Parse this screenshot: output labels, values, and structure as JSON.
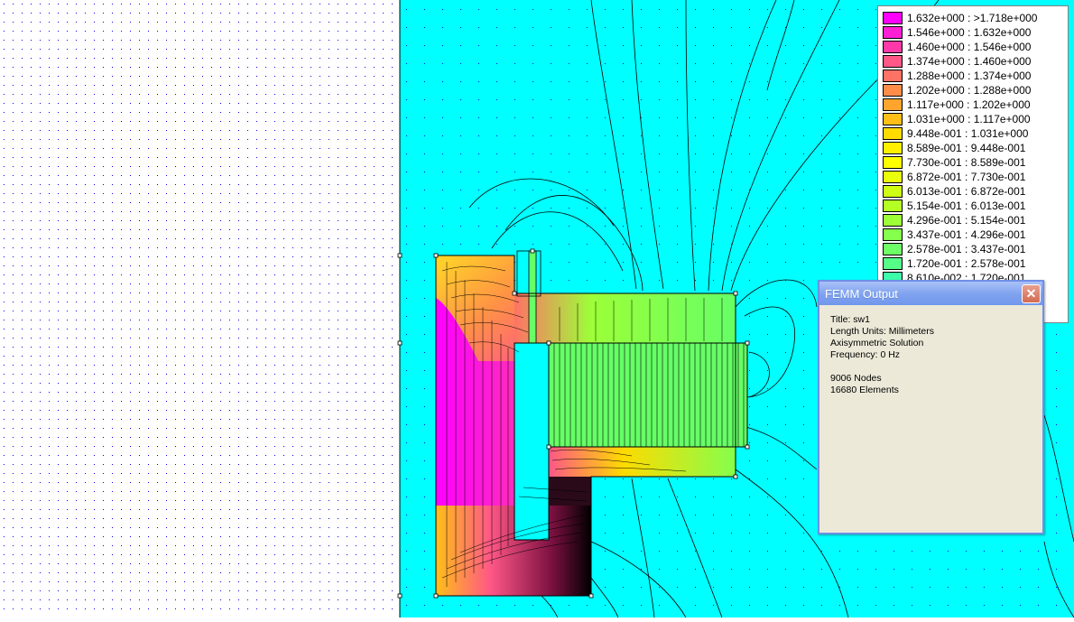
{
  "colors": {
    "background_field": "#00ffff",
    "grid_dot": "#0000ff",
    "contour": "#000000"
  },
  "legend": {
    "entries": [
      {
        "label": "1.632e+000 : >1.718e+000",
        "color": "#ff00ff"
      },
      {
        "label": "1.546e+000 : 1.632e+000",
        "color": "#ff1fd5"
      },
      {
        "label": "1.460e+000 : 1.546e+000",
        "color": "#ff3aa8"
      },
      {
        "label": "1.374e+000 : 1.460e+000",
        "color": "#ff5787"
      },
      {
        "label": "1.288e+000 : 1.374e+000",
        "color": "#ff7266"
      },
      {
        "label": "1.202e+000 : 1.288e+000",
        "color": "#ff8c49"
      },
      {
        "label": "1.117e+000 : 1.202e+000",
        "color": "#ffa52e"
      },
      {
        "label": "1.031e+000 : 1.117e+000",
        "color": "#ffbf18"
      },
      {
        "label": "9.448e-001 : 1.031e+000",
        "color": "#ffdb00"
      },
      {
        "label": "8.589e-001 : 9.448e-001",
        "color": "#fff000"
      },
      {
        "label": "7.730e-001 : 8.589e-001",
        "color": "#ffff00"
      },
      {
        "label": "6.872e-001 : 7.730e-001",
        "color": "#e8ff08"
      },
      {
        "label": "6.013e-001 : 6.872e-001",
        "color": "#cfff14"
      },
      {
        "label": "5.154e-001 : 6.013e-001",
        "color": "#b4ff24"
      },
      {
        "label": "4.296e-001 : 5.154e-001",
        "color": "#9cff38"
      },
      {
        "label": "3.437e-001 : 4.296e-001",
        "color": "#84ff4c"
      },
      {
        "label": "2.578e-001 : 3.437e-001",
        "color": "#6eff66"
      },
      {
        "label": "1.720e-001 : 2.578e-001",
        "color": "#55ff88"
      },
      {
        "label": "8.610e-002 : 1.720e-001",
        "color": "#3dffaa"
      }
    ]
  },
  "output_window": {
    "title": "FEMM Output",
    "close_label": "✕",
    "title_line": "Title: sw1",
    "length_units": "Length Units: Millimeters",
    "solution": "Axisymmetric Solution",
    "frequency": "Frequency: 0 Hz",
    "nodes": "9006 Nodes",
    "elements": "16680 Elements"
  }
}
